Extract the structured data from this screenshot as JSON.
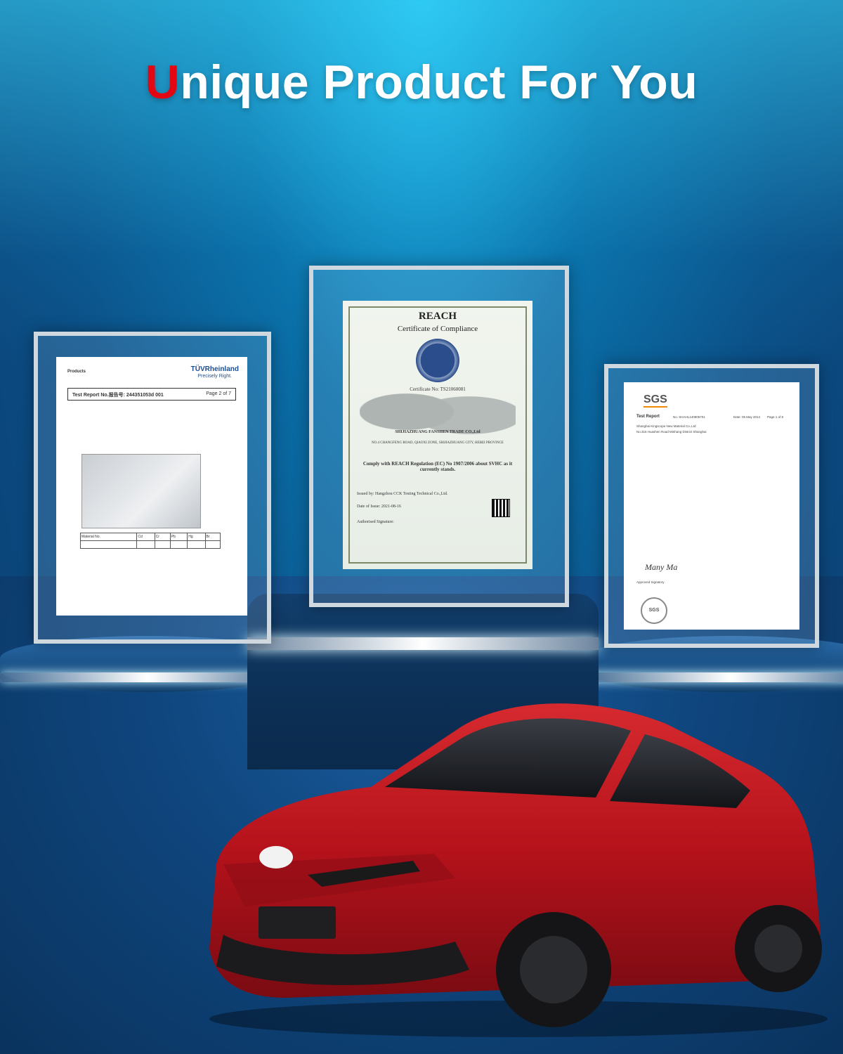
{
  "headline": {
    "first_letter": "U",
    "rest": "nique Product For You"
  },
  "colors": {
    "accent": "#e30613",
    "headline_text": "#ffffff",
    "background": "#0b4f86",
    "car_body": "#b5121b"
  },
  "certificates": {
    "tuv": {
      "brand": "TÜVRheinland",
      "brand_tagline": "Precisely Right.",
      "header_label": "Products",
      "title": "Test Report No.报告号: 244351053d 001",
      "page": "Page 2 of 7",
      "table_headers": [
        "Material No.",
        "Cd",
        "Cr",
        "Pb",
        "Hg",
        "Br"
      ]
    },
    "reach": {
      "title": "REACH",
      "subtitle": "Certificate of Compliance",
      "certificate_no": "Certificate No: TS21060081",
      "company": "SHIJIAZHUANG FANSHEN TRADE CO.,Ltd",
      "address": "NO.4 CHANGFENG ROAD, QIAOXI ZONE, SHIJIAZHUANG CITY, HEBEI PROVINCE",
      "statement": "Comply with REACH Regulation (EC) No 1907/2006 about SVHC as it currently stands.",
      "issued_by": "Issued by: Hangzhou CCK Testing Technical Co.,Ltd.",
      "date_of_issue": "Date of Issue: 2021-08-16",
      "signatory_label": "Authorised Signature:"
    },
    "sgs": {
      "logo": "SGS",
      "title": "Test Report",
      "report_no": "No. SHAHL140805701",
      "date": "Date: 05 May 2014",
      "page": "Page 1 of 8",
      "applicant": "Shanghai Kingscope New Material Co.,Ltd",
      "address": "No.315 Huashen Road Minhang District Shanghai",
      "signature": "Many Ma",
      "signatory_title": "Approved Signatory"
    }
  }
}
